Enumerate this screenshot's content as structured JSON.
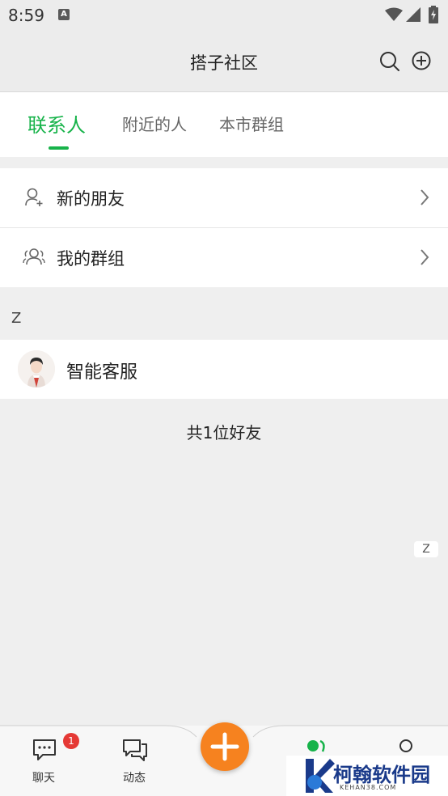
{
  "status_bar": {
    "time": "8:59",
    "notification_badge": "A"
  },
  "header": {
    "title": "搭子社区"
  },
  "tabs": [
    {
      "label": "联系人",
      "active": true
    },
    {
      "label": "附近的人",
      "active": false
    },
    {
      "label": "本市群组",
      "active": false
    }
  ],
  "menu": [
    {
      "label": "新的朋友",
      "icon": "add-user-icon"
    },
    {
      "label": "我的群组",
      "icon": "group-icon"
    }
  ],
  "section_letter": "Z",
  "contacts": [
    {
      "name": "智能客服",
      "icon": "avatar"
    }
  ],
  "friend_count": "共1位好友",
  "index_letter": "Z",
  "bottom_nav": {
    "chat": {
      "label": "聊天",
      "badge": "1"
    },
    "moments": {
      "label": "动态"
    }
  },
  "watermark": {
    "text": "柯翰软件园",
    "subtext": "KEHAN38.COM"
  },
  "colors": {
    "accent": "#17b34a",
    "fab": "#f6821f",
    "badge": "#e53935"
  }
}
